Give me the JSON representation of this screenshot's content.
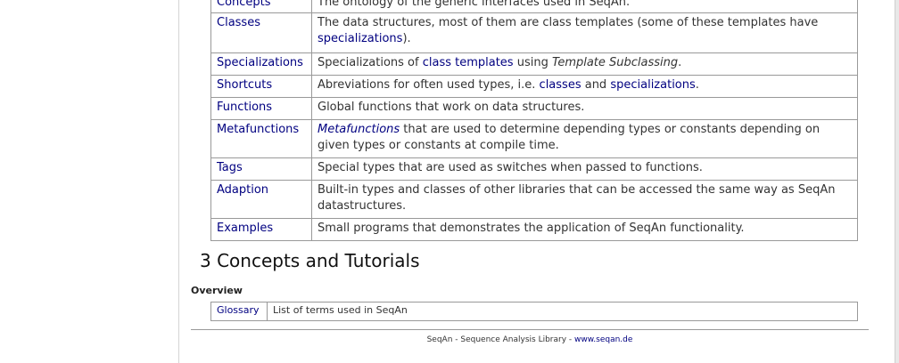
{
  "main_table": {
    "rows": [
      {
        "name": "Concepts",
        "desc": "The ontology of the generic interfaces used in SeqAn."
      },
      {
        "name": "Classes",
        "desc_a": "The data structures, most of them are class templates (some of these templates have ",
        "desc_link": "specializations",
        "desc_b": ")."
      },
      {
        "name": "Specializations",
        "desc_a": "Specializations of ",
        "desc_link": "class templates",
        "desc_b": " using ",
        "desc_em": "Template Subclassing",
        "desc_c": "."
      },
      {
        "name": "Shortcuts",
        "desc_a": "Abreviations for often used types, i.e. ",
        "desc_link1": "classes",
        "desc_b": " and ",
        "desc_link2": "specializations",
        "desc_c": "."
      },
      {
        "name": "Functions",
        "desc": "Global functions that work on data structures."
      },
      {
        "name": "Metafunctions",
        "desc_em": "Metafunctions",
        "desc_a": " that are used to determine depending types or constants depending on given types or constants at compile time."
      },
      {
        "name": "Tags",
        "desc": "Special types that are used as switches when passed to functions."
      },
      {
        "name": "Adaption",
        "desc": "Built-in types and classes of other libraries that can be accessed the same way as SeqAn datastructures."
      },
      {
        "name": "Examples",
        "desc": "Small programs that demonstrates the application of SeqAn functionality."
      }
    ]
  },
  "section_heading": "3 Concepts and Tutorials",
  "overview_label": "Overview",
  "glossary": {
    "name": "Glossary",
    "desc": "List of terms used in SeqAn"
  },
  "footer": {
    "text": "SeqAn - Sequence Analysis Library - ",
    "link": "www.seqan.de"
  }
}
